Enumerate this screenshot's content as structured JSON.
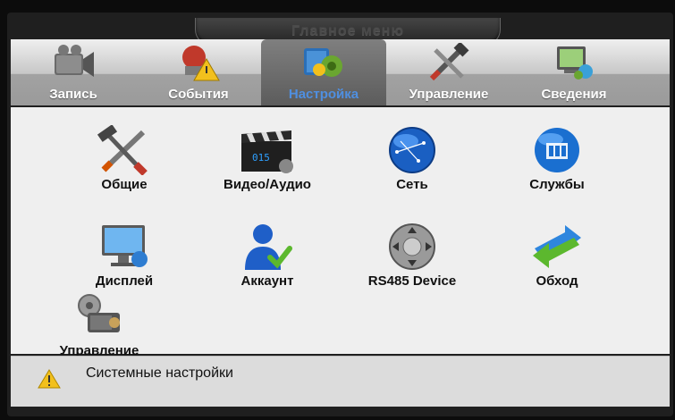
{
  "window": {
    "title": "Главное меню"
  },
  "nav": [
    {
      "label": "Запись",
      "icon": "video-camera-icon"
    },
    {
      "label": "События",
      "icon": "alarm-warning-icon"
    },
    {
      "label": "Настройка",
      "icon": "settings-gears-icon",
      "active": true
    },
    {
      "label": "Управление",
      "icon": "tools-icon"
    },
    {
      "label": "Сведения",
      "icon": "system-info-icon"
    }
  ],
  "items": [
    {
      "label": "Общие",
      "icon": "hammer-wrench-icon"
    },
    {
      "label": "Видео/Аудио",
      "icon": "clapperboard-icon"
    },
    {
      "label": "Сеть",
      "icon": "network-globe-icon"
    },
    {
      "label": "Службы",
      "icon": "services-globe-icon"
    },
    {
      "label": "Дисплей",
      "icon": "display-monitor-icon"
    },
    {
      "label": "Аккаунт",
      "icon": "user-account-icon"
    },
    {
      "label": "RS485 Device",
      "icon": "ptz-direction-icon"
    },
    {
      "label": "Обход",
      "icon": "tour-arrows-icon"
    },
    {
      "label": "Управление",
      "icon": "camera-gear-icon"
    }
  ],
  "status": {
    "text": "Системные настройки",
    "icon": "warning-icon"
  },
  "colors": {
    "active_tab_text": "#4f8fe0",
    "content_bg": "#efefef"
  }
}
